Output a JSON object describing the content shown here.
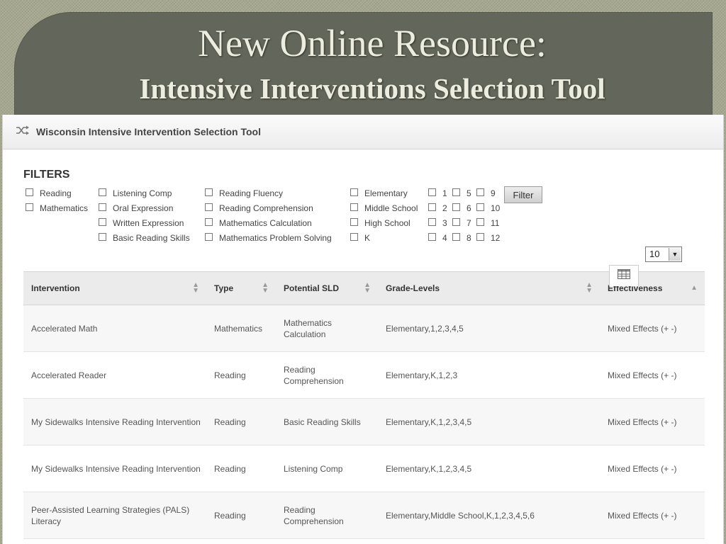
{
  "slide": {
    "title": "New Online Resource:",
    "subtitle": "Intensive Interventions Selection Tool"
  },
  "app": {
    "title": "Wisconsin Intensive Intervention Selection Tool",
    "icon": "shuffle-icon"
  },
  "filters": {
    "heading": "FILTERS",
    "subjects": [
      "Reading",
      "Mathematics"
    ],
    "skills": [
      "Listening Comp",
      "Oral Expression",
      "Written Expression",
      "Basic Reading Skills"
    ],
    "skills2": [
      "Reading Fluency",
      "Reading Comprehension",
      "Mathematics Calculation",
      "Mathematics Problem Solving"
    ],
    "levels": [
      "Elementary",
      "Middle School",
      "High School",
      "K"
    ],
    "grades_a": [
      "1",
      "2",
      "3",
      "4"
    ],
    "grades_b": [
      "5",
      "6",
      "7",
      "8"
    ],
    "grades_c": [
      "9",
      "10",
      "11",
      "12"
    ],
    "button_label": "Filter"
  },
  "page_size": {
    "value": "10"
  },
  "table": {
    "headers": [
      "Intervention",
      "Type",
      "Potential SLD",
      "Grade-Levels",
      "Effectiveness"
    ],
    "rows": [
      [
        "Accelerated Math",
        "Mathematics",
        "Mathematics Calculation",
        "Elementary,1,2,3,4,5",
        "Mixed Effects (+ -)"
      ],
      [
        "Accelerated Reader",
        "Reading",
        "Reading Comprehension",
        "Elementary,K,1,2,3",
        "Mixed Effects (+ -)"
      ],
      [
        "My Sidewalks Intensive Reading Intervention",
        "Reading",
        "Basic Reading Skills",
        "Elementary,K,1,2,3,4,5",
        "Mixed Effects (+ -)"
      ],
      [
        "My Sidewalks Intensive Reading Intervention",
        "Reading",
        "Listening Comp",
        "Elementary,K,1,2,3,4,5",
        "Mixed Effects (+ -)"
      ],
      [
        "Peer-Assisted Learning Strategies (PALS) Literacy",
        "Reading",
        "Reading Comprehension",
        "Elementary,Middle School,K,1,2,3,4,5,6",
        "Mixed Effects (+ -)"
      ]
    ]
  }
}
